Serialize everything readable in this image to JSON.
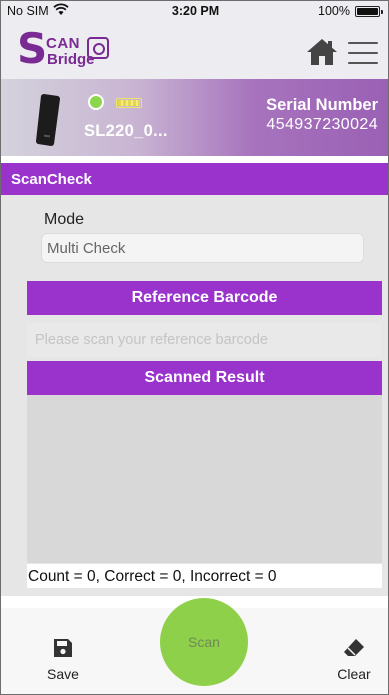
{
  "status_bar": {
    "carrier": "No SIM",
    "time": "3:20 PM",
    "battery_percent": "100%"
  },
  "app_bar": {
    "logo": {
      "text_s": "S",
      "text_can": "CAN",
      "text_bridge": "Bridge"
    }
  },
  "device": {
    "name": "SL220_0...",
    "serial_label": "Serial Number",
    "serial_value": "454937230024",
    "connection_color": "#8bd64a"
  },
  "section": {
    "title": "ScanCheck"
  },
  "form": {
    "mode_label": "Mode",
    "mode_value": "Multi Check",
    "reference_header": "Reference Barcode",
    "reference_placeholder": "Please scan your reference barcode",
    "reference_value": "",
    "result_header": "Scanned Result",
    "count_summary": "Count = 0, Correct = 0, Incorrect = 0"
  },
  "toolbar": {
    "save_label": "Save",
    "scan_label": "Scan",
    "clear_label": "Clear"
  },
  "colors": {
    "accent_purple": "#9933cc",
    "scan_green": "#8ed04a"
  }
}
